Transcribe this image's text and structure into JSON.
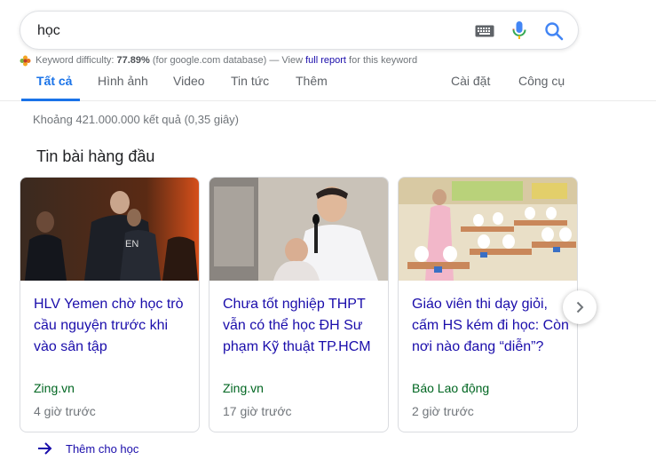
{
  "search": {
    "query": "học"
  },
  "keyword_difficulty": {
    "label": "Keyword difficulty:",
    "value": "77.89%",
    "database": "(for google.com database) — View",
    "link": "full report",
    "suffix": "for this keyword"
  },
  "tabs": {
    "items": [
      {
        "label": "Tất cả"
      },
      {
        "label": "Hình ảnh"
      },
      {
        "label": "Video"
      },
      {
        "label": "Tin tức"
      },
      {
        "label": "Thêm"
      }
    ],
    "settings": "Cài đặt",
    "tools": "Công cụ"
  },
  "result_stats": "Khoảng 421.000.000 kết quả (0,35 giây)",
  "top_stories": {
    "heading": "Tin bài hàng đầu",
    "cards": [
      {
        "title": "HLV Yemen chờ học trò cầu nguyện trước khi vào sân tập",
        "source": "Zing.vn",
        "time": "4 giờ trước"
      },
      {
        "title": "Chưa tốt nghiệp THPT vẫn có thể học ĐH Sư phạm Kỹ thuật TP.HCM",
        "source": "Zing.vn",
        "time": "17 giờ trước"
      },
      {
        "title": "Giáo viên thi dạy giỏi, cấm HS kém đi học: Còn nơi nào đang “diễn”?",
        "source": "Báo Lao động",
        "time": "2 giờ trước"
      }
    ],
    "more_label": "Thêm cho học"
  },
  "colors": {
    "link": "#1a0dab",
    "accent": "#1a73e8",
    "source": "#006621",
    "muted": "#70757a"
  },
  "icons": [
    "keyboard-icon",
    "microphone-icon",
    "search-icon",
    "chevron-right-icon",
    "arrow-right-icon",
    "flower-icon"
  ]
}
